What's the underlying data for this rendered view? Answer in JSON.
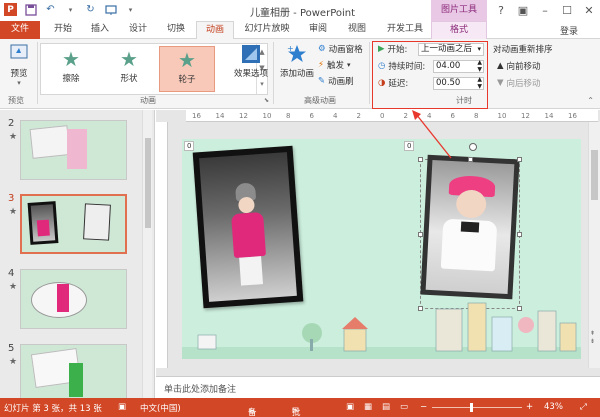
{
  "window": {
    "title": "儿童相册 - PowerPoint",
    "contextual_tab_group": "图片工具",
    "login": "登录"
  },
  "tabs": [
    "文件",
    "开始",
    "插入",
    "设计",
    "切换",
    "动画",
    "幻灯片放映",
    "审阅",
    "视图",
    "开发工具",
    "格式"
  ],
  "active_tab": "动画",
  "ribbon": {
    "preview_group": {
      "button": "预览",
      "label": "预览"
    },
    "animation_group": {
      "label": "动画",
      "gallery": [
        "擦除",
        "形状",
        "轮子"
      ],
      "selected": "轮子",
      "effect_options": "效果选项"
    },
    "advanced_group": {
      "label": "高级动画",
      "add_animation": "添加动画",
      "animation_pane": "动画窗格",
      "trigger": "触发",
      "animation_painter": "动画刷"
    },
    "timing_group": {
      "label": "计时",
      "start_label": "开始:",
      "start_value": "上一动画之后",
      "duration_label": "持续时间:",
      "duration_value": "04.00",
      "delay_label": "延迟:",
      "delay_value": "00.50",
      "reorder_title": "对动画重新排序",
      "move_earlier": "向前移动",
      "move_later": "向后移动"
    }
  },
  "slides": [
    {
      "number": "2",
      "star": "★"
    },
    {
      "number": "3",
      "star": "★"
    },
    {
      "number": "4",
      "star": "★"
    },
    {
      "number": "5",
      "star": "★"
    }
  ],
  "selected_slide": "3",
  "slide": {
    "anim_tag_1": "0",
    "anim_tag_2": "0"
  },
  "ruler_ticks": [
    "16",
    "14",
    "12",
    "10",
    "8",
    "6",
    "4",
    "2",
    "0",
    "2",
    "4",
    "6",
    "8",
    "10",
    "12",
    "14",
    "16"
  ],
  "notes_placeholder": "单击此处添加备注",
  "status": {
    "slide_info": "幻灯片 第 3 张，共 13 张",
    "language": "中文(中国)",
    "notes": "备注",
    "comments": "批注",
    "zoom": "43%"
  },
  "colors": {
    "accent": "#d24726",
    "contextual": "#e9c8e5",
    "highlight_box": "#e8382d",
    "slide_bg": "#cceedd"
  }
}
